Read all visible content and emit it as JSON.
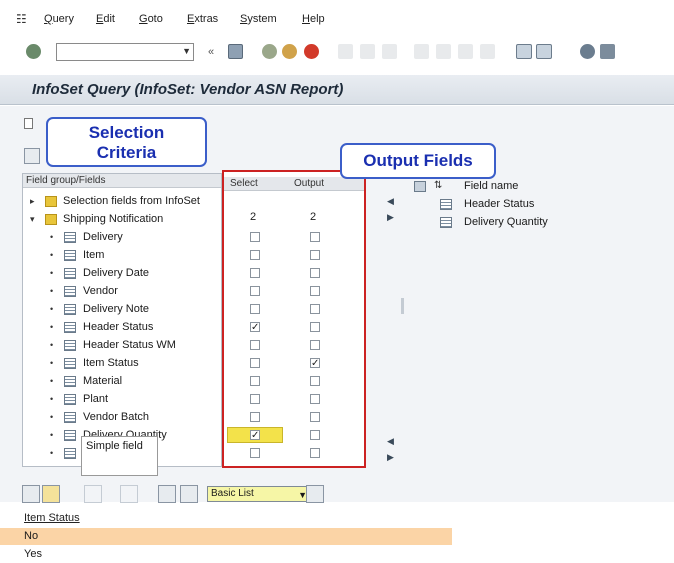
{
  "menubar": {
    "items": [
      "Query",
      "Edit",
      "Goto",
      "Extras",
      "System",
      "Help"
    ]
  },
  "toolbar": {
    "command_value": "",
    "icons": [
      "enter-icon",
      "save-icon",
      "back-icon",
      "exit-icon",
      "cancel-icon",
      "print-icon",
      "find-icon",
      "find-next-icon",
      "first-page-icon",
      "prev-page-icon",
      "next-page-icon",
      "last-page-icon",
      "create-session-icon",
      "shortcut-icon",
      "help-icon",
      "layout-icon"
    ]
  },
  "title": "InfoSet Query (InfoSet: Vendor ASN Report)",
  "callouts": {
    "selection": "Selection Criteria",
    "output": "Output Fields"
  },
  "tree": {
    "header": "Field group/Fields",
    "rows": [
      {
        "label": "Selection fields from InfoSet",
        "type": "folder",
        "level": 0
      },
      {
        "label": "Shipping Notification",
        "type": "folder",
        "level": 0
      },
      {
        "label": "Delivery",
        "type": "field",
        "level": 1
      },
      {
        "label": "Item",
        "type": "field",
        "level": 1
      },
      {
        "label": "Delivery Date",
        "type": "field",
        "level": 1
      },
      {
        "label": "Vendor",
        "type": "field",
        "level": 1
      },
      {
        "label": "Delivery Note",
        "type": "field",
        "level": 1
      },
      {
        "label": "Header Status",
        "type": "field",
        "level": 1
      },
      {
        "label": "Header Status WM",
        "type": "field",
        "level": 1
      },
      {
        "label": "Item Status",
        "type": "field",
        "level": 1
      },
      {
        "label": "Material",
        "type": "field",
        "level": 1
      },
      {
        "label": "Plant",
        "type": "field",
        "level": 1
      },
      {
        "label": "Vendor Batch",
        "type": "field",
        "level": 1
      },
      {
        "label": "Delivery Quantity",
        "type": "field",
        "level": 1
      },
      {
        "label": "",
        "type": "field",
        "level": 1
      }
    ]
  },
  "columns": {
    "select_header": "Select",
    "output_header": "Output",
    "counts": {
      "select": "2",
      "output": "2"
    },
    "select_checked": [
      false,
      false,
      false,
      false,
      false,
      true,
      false,
      false,
      false,
      false,
      false,
      true,
      false
    ],
    "output_checked": [
      false,
      false,
      false,
      false,
      false,
      false,
      false,
      true,
      false,
      false,
      false,
      false,
      false
    ]
  },
  "output_panel": {
    "header": "Field name",
    "rows": [
      "Header Status",
      "Delivery Quantity"
    ]
  },
  "tooltip": "Simple field",
  "bottom_toolbar": {
    "layout_label": "Basic List"
  },
  "bottom_list": {
    "header": "Item Status",
    "rows": [
      "No",
      "Yes"
    ]
  },
  "colors": {
    "callout_border": "#3b5ec9",
    "callout_text": "#1a2fb0",
    "column_border": "#cc2222",
    "selected_row": "#fbd4a6"
  }
}
